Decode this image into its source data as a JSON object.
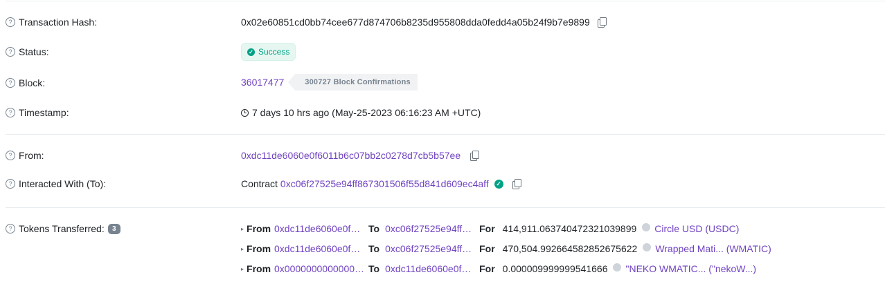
{
  "rows": {
    "tx_hash": {
      "label": "Transaction Hash:",
      "value": "0x02e60851cd0bb74cee677d874706b8235d955808dda0fedd4a05b24f9b7e9899"
    },
    "status": {
      "label": "Status:",
      "value": "Success"
    },
    "block": {
      "label": "Block:",
      "value": "36017477",
      "confirmations": "300727 Block Confirmations"
    },
    "timestamp": {
      "label": "Timestamp:",
      "value": "7 days 10 hrs ago (May-25-2023 06:16:23 AM +UTC)"
    },
    "from": {
      "label": "From:",
      "value": "0xdc11de6060e0f6011b6c07bb2c0278d7cb5b57ee"
    },
    "interacted": {
      "label": "Interacted With (To):",
      "prefix": "Contract",
      "value": "0xc06f27525e94ff867301506f55d841d609ec4aff"
    },
    "tokens": {
      "label": "Tokens Transferred:",
      "count": "3"
    }
  },
  "keywords": {
    "from": "From",
    "to": "To",
    "for": "For"
  },
  "transfers": [
    {
      "from": "0xdc11de6060e0f…",
      "to": "0xc06f27525e94ff…",
      "amount": "414,911.063740472321039899",
      "token": "Circle USD (USDC)"
    },
    {
      "from": "0xdc11de6060e0f…",
      "to": "0xc06f27525e94ff…",
      "amount": "470,504.992664582852675622",
      "token": "Wrapped Mati... (WMATIC)"
    },
    {
      "from": "0x0000000000000…",
      "to": "0xdc11de6060e0f…",
      "amount": "0.000009999999541666",
      "token": "\"NEKO WMATIC... (\"nekoW...)"
    }
  ],
  "colors": {
    "link": "#6f42c1",
    "success": "#00a186",
    "muted": "#77838f"
  }
}
